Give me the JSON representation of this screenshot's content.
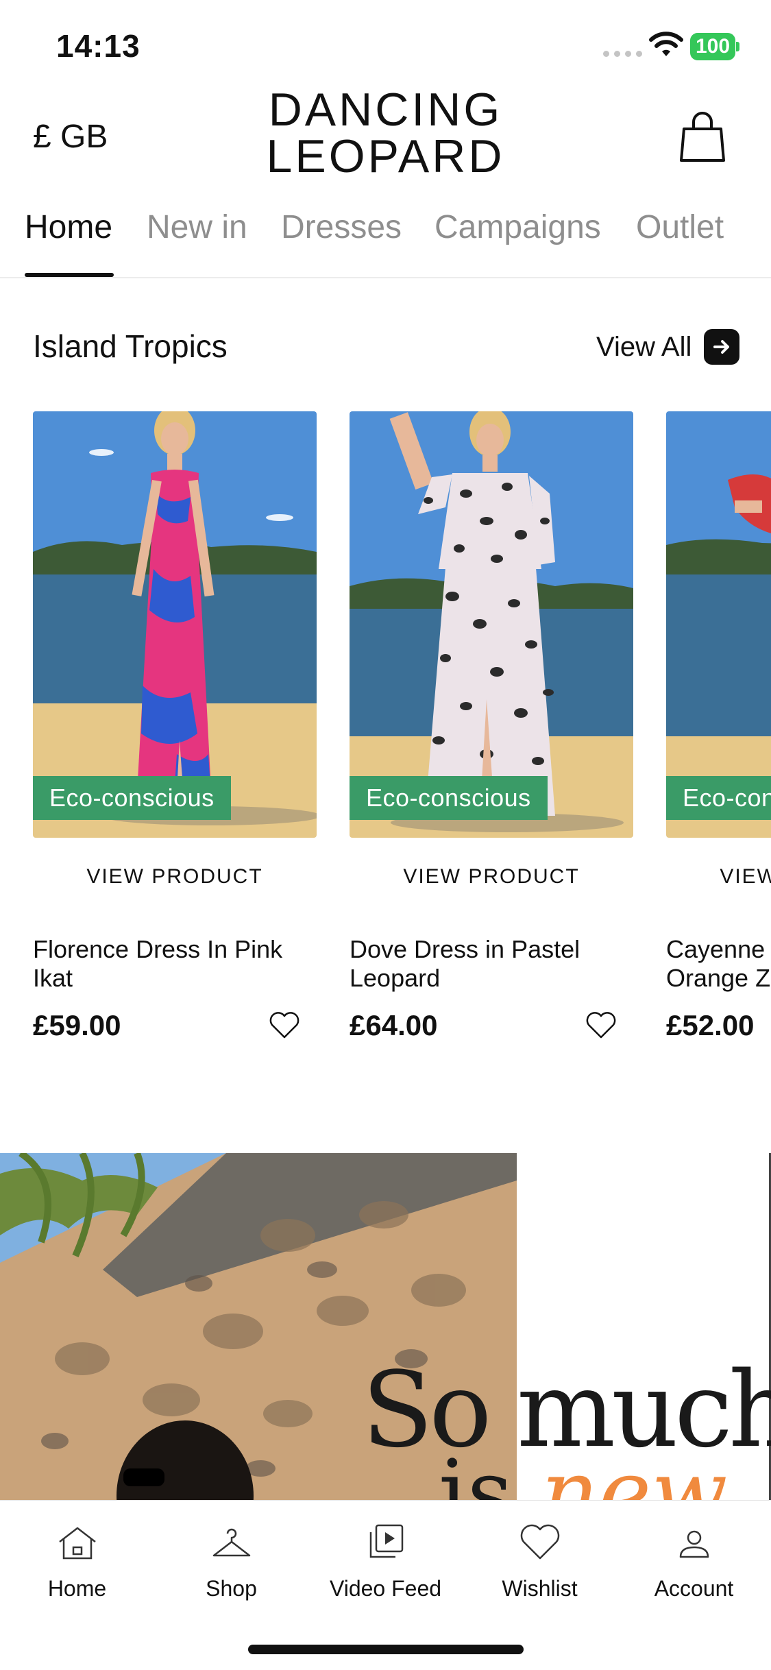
{
  "status_bar": {
    "time": "14:13",
    "battery": "100"
  },
  "header": {
    "currency": "£ GB",
    "brand_line1": "DANCING",
    "brand_line2": "LEOPARD"
  },
  "tabs": [
    {
      "label": "Home",
      "active": true
    },
    {
      "label": "New in",
      "active": false
    },
    {
      "label": "Dresses",
      "active": false
    },
    {
      "label": "Campaigns",
      "active": false
    },
    {
      "label": "Outlet",
      "active": false
    }
  ],
  "section": {
    "title": "Island Tropics",
    "view_all": "View All"
  },
  "products": [
    {
      "badge": "Eco-conscious",
      "cta": "VIEW PRODUCT",
      "name": "Florence Dress In Pink Ikat",
      "price": "£59.00"
    },
    {
      "badge": "Eco-conscious",
      "cta": "VIEW PRODUCT",
      "name": "Dove Dress in Pastel Leopard",
      "price": "£64.00"
    },
    {
      "badge": "Eco-conscious",
      "cta": "VIEW PRODUCT",
      "name": "Cayenne Dress in Orange Z",
      "price": "£52.00"
    }
  ],
  "banner": {
    "line1": "So much",
    "line2_prefix": "is ",
    "line2_accent": "new"
  },
  "bottom_nav": [
    {
      "label": "Home",
      "icon": "home-icon"
    },
    {
      "label": "Shop",
      "icon": "hanger-icon"
    },
    {
      "label": "Video Feed",
      "icon": "video-feed-icon"
    },
    {
      "label": "Wishlist",
      "icon": "heart-icon"
    },
    {
      "label": "Account",
      "icon": "person-icon"
    }
  ],
  "colors": {
    "eco_badge": "#3a9b67",
    "battery": "#34c759",
    "accent_orange": "#f08a3e"
  }
}
